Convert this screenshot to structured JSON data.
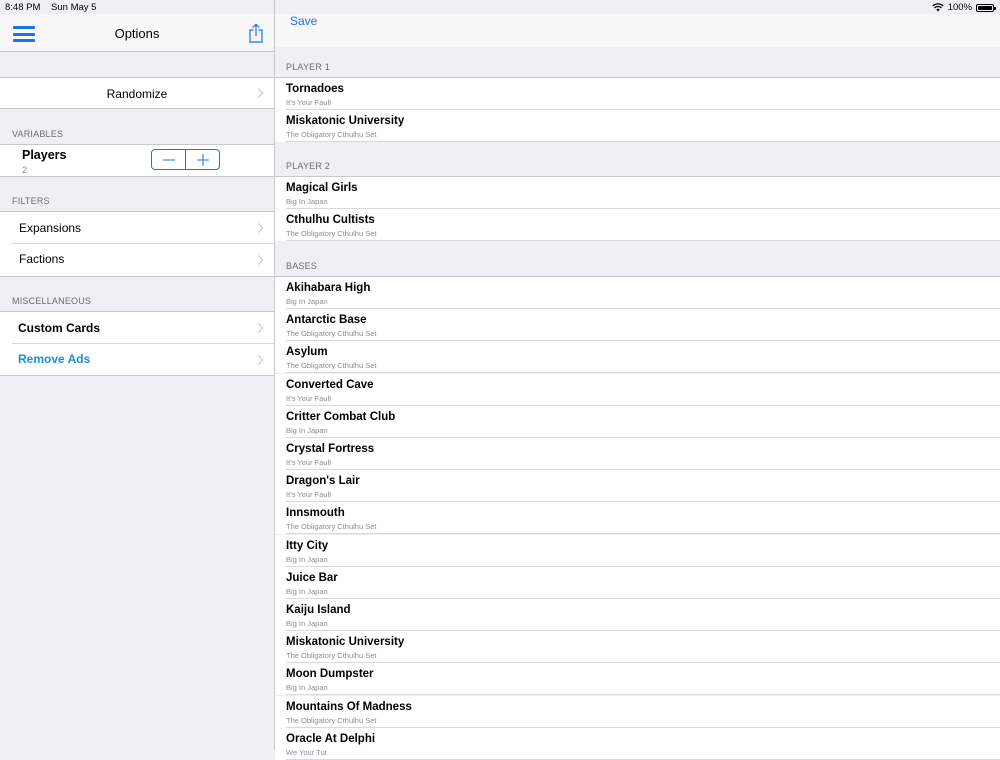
{
  "status": {
    "time": "8:48 PM",
    "date": "Sun May 5",
    "battery": "100%",
    "battery_level": 1.0
  },
  "sidebar": {
    "title": "Options",
    "randomize_label": "Randomize",
    "variables_header": "VARIABLES",
    "players_label": "Players",
    "players_value": "2",
    "filters_header": "FILTERS",
    "expansions_label": "Expansions",
    "factions_label": "Factions",
    "misc_header": "MISCELLANEOUS",
    "custom_cards_label": "Custom Cards",
    "remove_ads_label": "Remove Ads"
  },
  "main": {
    "save_label": "Save",
    "player1_header": "PLAYER 1",
    "player1": [
      {
        "title": "Tornadoes",
        "subtitle": "It's Your Fault"
      },
      {
        "title": "Miskatonic University",
        "subtitle": "The Obligatory Cthulhu Set"
      }
    ],
    "player2_header": "PLAYER 2",
    "player2": [
      {
        "title": "Magical Girls",
        "subtitle": "Big In Japan"
      },
      {
        "title": "Cthulhu Cultists",
        "subtitle": "The Obligatory Cthulhu Set"
      }
    ],
    "bases_header": "BASES",
    "bases": [
      {
        "title": "Akihabara High",
        "subtitle": "Big In Japan"
      },
      {
        "title": "Antarctic Base",
        "subtitle": "The Obligatory Cthulhu Set"
      },
      {
        "title": "Asylum",
        "subtitle": "The Obligatory Cthulhu Set"
      },
      {
        "title": "Converted Cave",
        "subtitle": "It's Your Fault"
      },
      {
        "title": "Critter Combat Club",
        "subtitle": "Big In Japan"
      },
      {
        "title": "Crystal Fortress",
        "subtitle": "It's Your Fault"
      },
      {
        "title": "Dragon's Lair",
        "subtitle": "It's Your Fault"
      },
      {
        "title": "Innsmouth",
        "subtitle": "The Obligatory Cthulhu Set"
      },
      {
        "title": "Itty City",
        "subtitle": "Big In Japan"
      },
      {
        "title": "Juice Bar",
        "subtitle": "Big In Japan"
      },
      {
        "title": "Kaiju Island",
        "subtitle": "Big In Japan"
      },
      {
        "title": "Miskatonic University",
        "subtitle": "The Obligatory Cthulhu Set"
      },
      {
        "title": "Moon Dumpster",
        "subtitle": "Big In Japan"
      },
      {
        "title": "Mountains Of Madness",
        "subtitle": "The Obligatory Cthulhu Set"
      },
      {
        "title": "Oracle At Delphi",
        "subtitle": "We Your Tut"
      }
    ]
  },
  "colors": {
    "accent": "#1a73e8",
    "background": "#efeff4",
    "separator": "#c8c7cc"
  }
}
